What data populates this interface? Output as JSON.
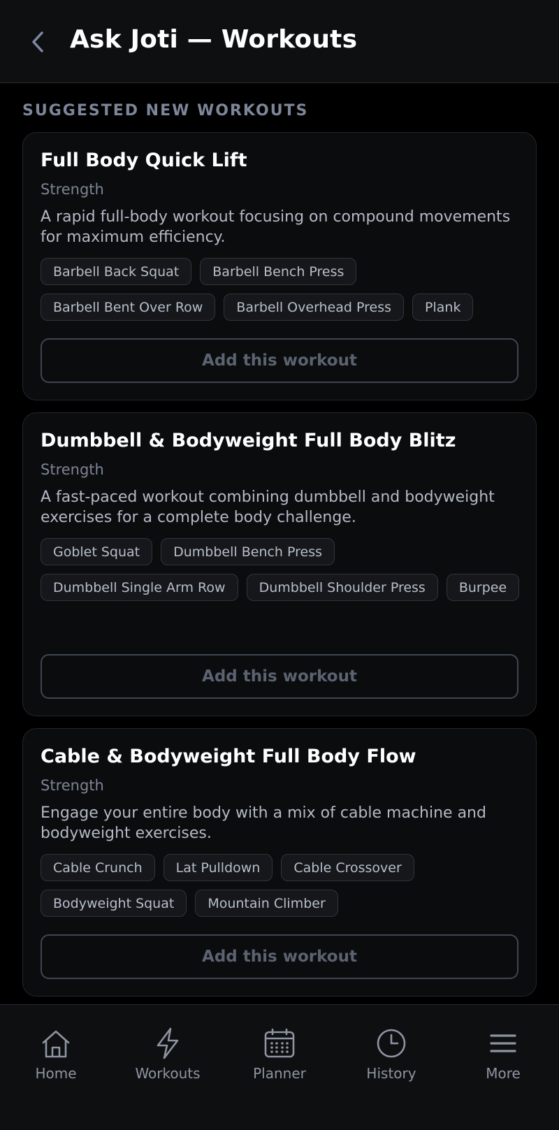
{
  "header": {
    "title": "Ask Joti — Workouts",
    "back_icon": "chevron-left-icon"
  },
  "section": {
    "label": "SUGGESTED NEW WORKOUTS"
  },
  "workouts": [
    {
      "title": "Full Body Quick Lift",
      "type": "Strength",
      "description": "A rapid full-body workout focusing on compound movements for maximum efficiency.",
      "exercises": [
        "Barbell Back Squat",
        "Barbell Bench Press",
        "Barbell Bent Over Row",
        "Barbell Overhead Press",
        "Plank"
      ],
      "button_label": "Add this workout"
    },
    {
      "title": "Dumbbell & Bodyweight Full Body Blitz",
      "type": "Strength",
      "description": "A fast-paced workout combining dumbbell and bodyweight exercises for a complete body challenge.",
      "exercises": [
        "Goblet Squat",
        "Dumbbell Bench Press",
        "Dumbbell Single Arm Row",
        "Dumbbell Shoulder Press",
        "Burpee"
      ],
      "button_label": "Add this workout"
    },
    {
      "title": "Cable & Bodyweight Full Body Flow",
      "type": "Strength",
      "description": "Engage your entire body with a mix of cable machine and bodyweight exercises.",
      "exercises": [
        "Cable Crunch",
        "Lat Pulldown",
        "Cable Crossover",
        "Bodyweight Squat",
        "Mountain Climber"
      ],
      "button_label": "Add this workout"
    }
  ],
  "tabbar": {
    "items": [
      {
        "label": "Home",
        "icon": "home-icon"
      },
      {
        "label": "Workouts",
        "icon": "lightning-icon"
      },
      {
        "label": "Planner",
        "icon": "calendar-icon"
      },
      {
        "label": "History",
        "icon": "clock-icon"
      },
      {
        "label": "More",
        "icon": "menu-icon"
      }
    ]
  },
  "colors": {
    "background": "#000000",
    "card_background": "#0b0c0e",
    "card_border": "#23262c",
    "secondary_text": "#7c8494",
    "button_text": "#5b6270"
  }
}
